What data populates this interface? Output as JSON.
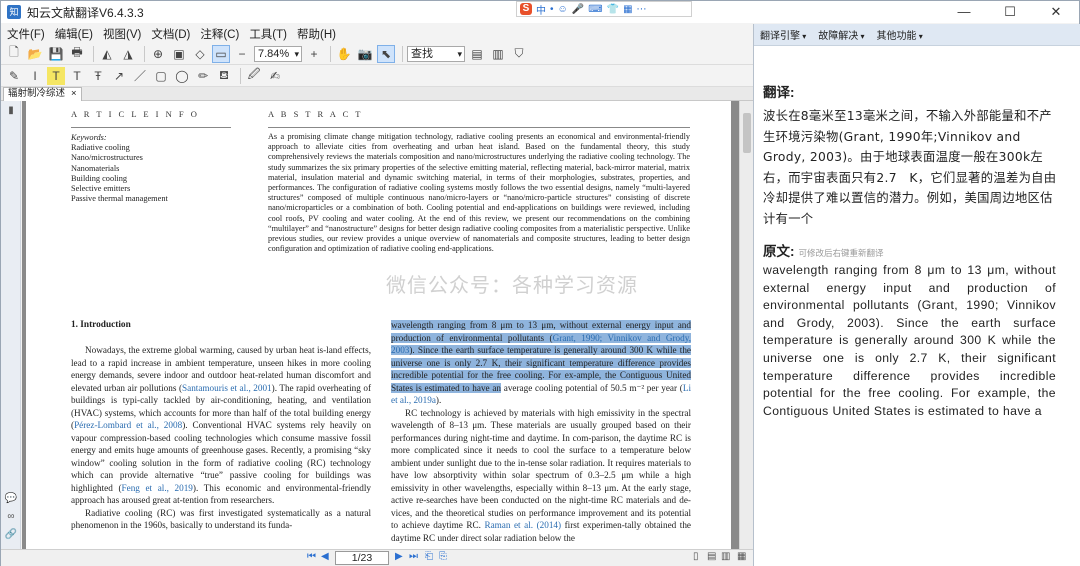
{
  "window": {
    "title": "知云文献翻译V6.4.3.3",
    "ime_labels": [
      "S",
      "中",
      "•",
      "☺",
      "🎤",
      "⌨",
      "👕",
      "▦",
      "⋯"
    ],
    "controls": [
      "—",
      "☐",
      "✕"
    ]
  },
  "menu": [
    "文件(F)",
    "编辑(E)",
    "视图(V)",
    "文档(D)",
    "注释(C)",
    "工具(T)",
    "帮助(H)"
  ],
  "toolbar": {
    "zoom_value": "7.84%",
    "find_placeholder": "查找"
  },
  "doc_tab": {
    "label": "辐射制冷综述",
    "close": "×"
  },
  "document": {
    "article_info_head": "A R T I C L E   I N F O",
    "abstract_head": "A B S T R A C T",
    "keywords_label": "Keywords:",
    "keywords": [
      "Radiative cooling",
      "Nano/microstructures",
      "Nanomaterials",
      "Building cooling",
      "Selective emitters",
      "Passive thermal management"
    ],
    "abstract": "As a promising climate change mitigation technology, radiative cooling presents an economical and environmental-friendly approach to alleviate cities from overheating and urban heat island. Based on the fundamental theory, this study comprehensively reviews the materials composition and nano/microstructures underlying the radiative cooling technology. The study summarizes the six primary properties of the selective emitting material, reflecting material, back-mirror material, matrix material, insulation material and dynamic switching material, in terms of their morphologies, substrates, properties, and performances. The configuration of radiative cooling systems mostly follows the two essential designs, namely “multi-layered structures” composed of multiple continuous nano/micro-layers or “nano/micro-particle structures” consisting of discrete nano/microparticles or a combination of both. Cooling potential and end-applications on buildings were reviewed, including cool roofs, PV cooling and water cooling. At the end of this review, we present our recommendations on the combining “multilayer” and “nanostructure” designs for better design radiative cooling composites from a materialistic perspective. Unlike previous studies, our review provides a unique overview of nanomaterials and composite structures, leading to better design configuration and optimization of radiative cooling end-applications.",
    "intro_heading": "1.  Introduction",
    "left_p1_a": "Nowadays, the extreme global warming, caused by urban heat is-land effects, lead to a rapid increase in ambient temperature, unseen hikes in more cooling energy demands, severe indoor and outdoor heat-related human discomfort and elevated urban air pollutions (",
    "left_p1_ref1": "Santamouris et al., 2001",
    "left_p1_b": "). The rapid overheating of buildings is typi-cally tackled by air-conditioning, heating, and ventilation (HVAC) systems, which accounts for more than half of the total building energy (",
    "left_p1_ref2": "Pérez-Lombard et al., 2008",
    "left_p1_c": "). Conventional HVAC systems rely heavily on vapour compression-based cooling technologies which consume massive fossil energy and emits huge amounts of greenhouse gases. Recently, a promising “sky window” cooling solution in the form of radiative cooling (RC) technology which can provide alternative “true” passive cooling for buildings was highlighted (",
    "left_p1_ref3": "Feng et al., 2019",
    "left_p1_d": "). This economic and environmental-friendly approach has aroused great at-tention from researchers.",
    "left_p2": "Radiative cooling (RC) was first investigated systematically as a natural phenomenon in the 1960s, basically to understand its funda-",
    "right_hl_a": "wavelength ranging from 8 μm to 13 μm, without external energy input and production of environmental pollutants (",
    "right_hl_ref": "Grant, 1990; Vinnikov and Grody, 2003",
    "right_hl_b": "). Since the earth surface temperature is generally around 300 K while the universe one is only 2.7 K, their significant temperature difference provides incredible potential for the free cooling. For ex-ample, the Contiguous United States is estimated to have an",
    "right_after_hl": " average cooling potential of 50.5 m⁻² per year (",
    "right_ref2": "Li et al., 2019a",
    "right_after_ref2": ").",
    "right_p2_a": "RC technology is achieved by materials with high emissivity in the spectral wavelength of 8–13 μm. These materials are usually grouped based on their performances during night-time and daytime. In com-parison, the daytime RC is more complicated since it needs to cool the surface to a temperature below ambient under sunlight due to the in-tense solar radiation. It requires materials to have low absorptivity within solar spectrum of 0.3–2.5 μm while a high emissivity in other wavelengths, especially within 8–13 μm. At the early stage, active re-searches have been conducted on the night-time RC materials and de-vices, and the theoretical studies on performance improvement and its potential to achieve daytime RC. ",
    "right_p2_ref": "Raman et al. (2014)",
    "right_p2_b": " first experimen-tally obtained the daytime RC under direct solar radiation below the",
    "watermark": "微信公众号：各种学习资源"
  },
  "status": {
    "page": "1/23"
  },
  "right_panel": {
    "menu": [
      "翻译引擎",
      "故障解决",
      "其他功能"
    ],
    "translation_heading": "翻译:",
    "translation_text": "波长在8毫米至13毫米之间，不输入外部能量和不产生环境污染物(Grant, 1990年;Vinnikov and Grody, 2003)。由于地球表面温度一般在300k左右，而宇宙表面只有2.7　K，它们显著的温差为自由冷却提供了难以置信的潜力。例如，美国周边地区估计有一个",
    "original_heading": "原文:",
    "original_hint": "可修改后右键重新翻译",
    "original_text": "wavelength ranging from 8 μm to 13 μm, without external energy input and production of environmental pollutants (Grant, 1990; Vinnikov and Grody, 2003). Since the earth surface temperature is generally around 300 K while the universe one is only 2.7 K, their significant temperature difference provides incredible potential for the free cooling. For example, the Contiguous United States is estimated to have a"
  }
}
